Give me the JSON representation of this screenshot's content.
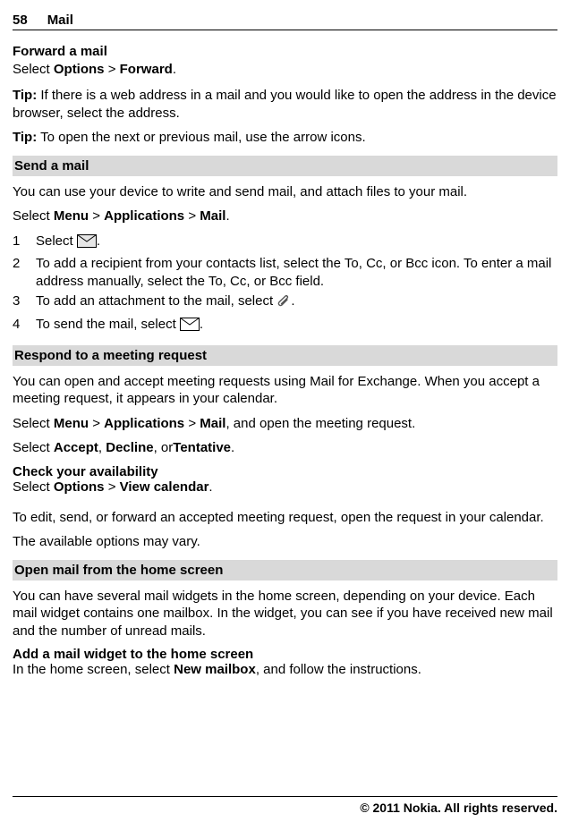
{
  "header": {
    "page_number": "58",
    "title": "Mail"
  },
  "forward": {
    "heading": "Forward a mail",
    "line_pre": "Select ",
    "options": "Options",
    "sep": "  > ",
    "forward": "Forward",
    "dot": "."
  },
  "tip1": {
    "label": "Tip:",
    "text": " If there is a web address in a mail and you would like to open the address in the device browser, select the address."
  },
  "tip2": {
    "label": "Tip:",
    "text": " To open the next or previous mail, use the arrow icons."
  },
  "send": {
    "bar": "Send a mail",
    "intro": "You can use your device to write and send mail, and attach files to your mail.",
    "select_pre": "Select ",
    "menu": "Menu",
    "sep1": "  > ",
    "apps": "Applications",
    "sep2": "  > ",
    "mail": "Mail",
    "dot": ".",
    "steps": [
      {
        "n": "1",
        "pre": "Select ",
        "post": "."
      },
      {
        "n": "2",
        "text": "To add a recipient from your contacts list, select the To, Cc, or Bcc icon. To enter a mail address manually, select the To, Cc, or Bcc field."
      },
      {
        "n": "3",
        "pre": "To add an attachment to the mail, select ",
        "post": "."
      },
      {
        "n": "4",
        "pre": "To send the mail, select ",
        "post": "."
      }
    ]
  },
  "respond": {
    "bar": "Respond to a meeting request",
    "intro": "You can open and accept meeting requests using Mail for Exchange. When you accept a meeting request, it appears in your calendar.",
    "select_pre": "Select ",
    "menu": "Menu",
    "sep1": "  > ",
    "apps": "Applications",
    "sep2": "  > ",
    "mail": "Mail",
    "tail": ", and open the meeting request.",
    "select2_pre": "Select ",
    "accept": "Accept",
    "comma1": ", ",
    "decline": "Decline",
    "comma2": ", or",
    "tentative": "Tentative",
    "dot": ".",
    "check_head": "Check your availability",
    "check_pre": "Select ",
    "options": "Options",
    "check_sep": "  > ",
    "view_cal": "View calendar",
    "check_dot": ".",
    "edit_para": "To edit, send, or forward an accepted meeting request, open the request in your calendar.",
    "vary": "The available options may vary."
  },
  "home": {
    "bar": "Open mail from the home screen",
    "intro": "You can have several mail widgets in the home screen, depending on your device. Each mail widget contains one mailbox. In the widget, you can see if you have received new mail and the number of unread mails.",
    "add_head": "Add a mail widget to the home screen",
    "add_pre": "In the home screen, select ",
    "new_mailbox": "New mailbox",
    "add_post": ", and follow the instructions."
  },
  "footer": "© 2011 Nokia. All rights reserved."
}
